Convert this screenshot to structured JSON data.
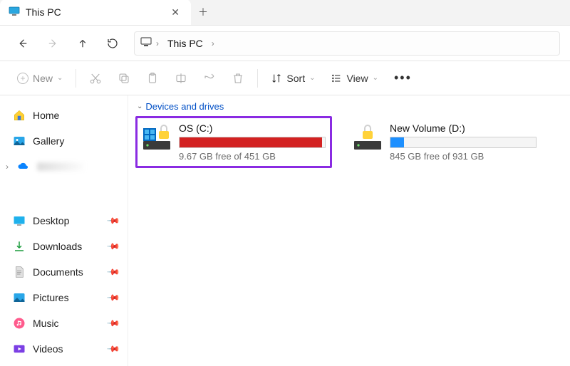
{
  "tab": {
    "title": "This PC",
    "close": "✕",
    "add": "＋"
  },
  "address": {
    "crumb": "This PC"
  },
  "toolbar": {
    "new_label": "New",
    "sort_label": "Sort",
    "view_label": "View"
  },
  "sidebar": {
    "top": [
      {
        "label": "Home"
      },
      {
        "label": "Gallery"
      },
      {
        "label": ""
      }
    ],
    "pins": [
      {
        "label": "Desktop"
      },
      {
        "label": "Downloads"
      },
      {
        "label": "Documents"
      },
      {
        "label": "Pictures"
      },
      {
        "label": "Music"
      },
      {
        "label": "Videos"
      }
    ]
  },
  "group": {
    "header": "Devices and drives"
  },
  "drives": [
    {
      "name": "OS (C:)",
      "free": "9.67 GB free of 451 GB",
      "fill_pct": 97.8,
      "fill_color": "#d32121",
      "selected": true
    },
    {
      "name": "New Volume (D:)",
      "free": "845 GB free of 931 GB",
      "fill_pct": 9.2,
      "fill_color": "#1e90ff",
      "selected": false
    }
  ]
}
